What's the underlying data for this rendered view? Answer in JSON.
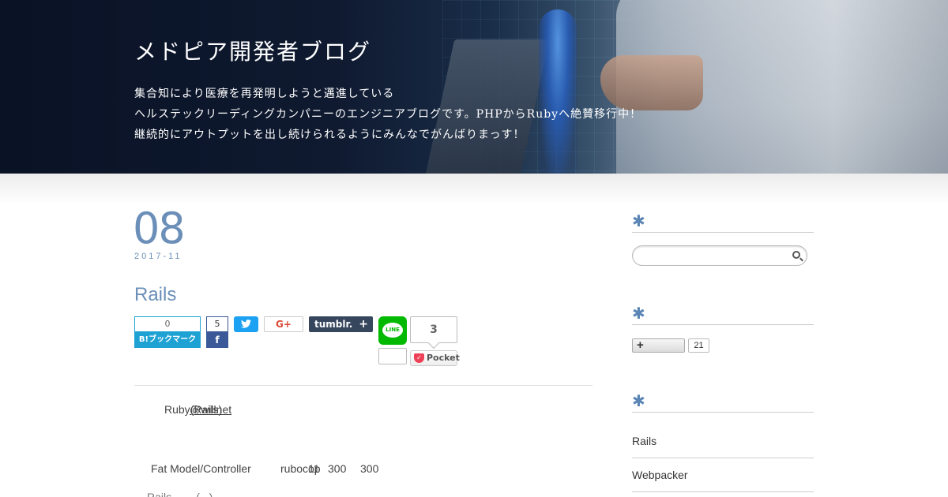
{
  "header": {
    "site_title": "メドピア開発者ブログ",
    "description": [
      "集合知により医療を再発明しようと邁進している",
      "ヘルステックリーディングカンパニーのエンジニアブログです。PHPからRubyへ絶賛移行中！",
      "継続的にアウトプットを出し続けられるようにみんなでがんばりまっす！"
    ]
  },
  "post": {
    "day": "08",
    "year_month": "2017-11",
    "title": "Rails",
    "share": {
      "hatena_count": "0",
      "hatena_label": "B!ブックマーク",
      "facebook_count": "5",
      "facebook_icon": "f",
      "twitter_icon": "t",
      "gplus_label": "G+",
      "tumblr_label": "tumblr.",
      "tumblr_plus": "+",
      "line_label": "LINE",
      "line_count": "3",
      "pocket_label": "Pocket"
    },
    "body": {
      "line1_prefix": "Ruby",
      "line1_link": "(Rails)",
      "line1_overlap": "@willnet",
      "line2": [
        "Fat Model/Controller",
        "rubocop",
        "11",
        "300",
        "300"
      ],
      "line3": "Rails                   ...          ...(...)"
    }
  },
  "sidebar": {
    "widget_marks": [
      "✱",
      "✱",
      "✱"
    ],
    "follow_label": "+",
    "follow_count": "21",
    "categories": [
      "Rails",
      "Webpacker"
    ]
  }
}
